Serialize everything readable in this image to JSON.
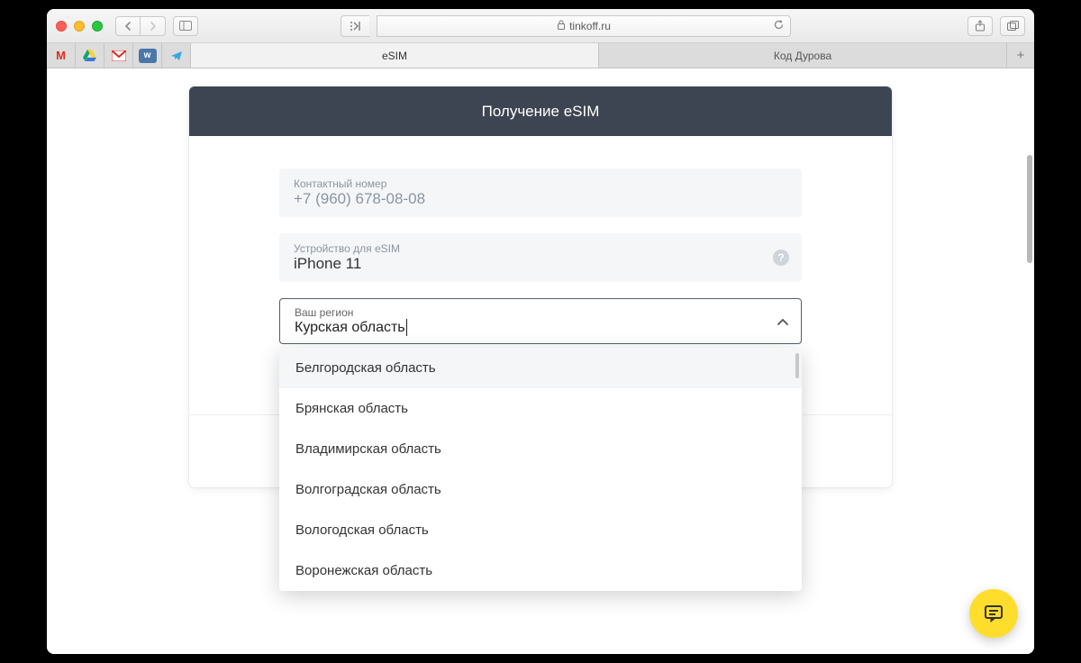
{
  "browser": {
    "url_host": "tinkoff.ru",
    "tabs": [
      {
        "label": "eSIM",
        "active": true
      },
      {
        "label": "Код Дурова",
        "active": false
      }
    ],
    "favicons": [
      "gmail",
      "drive",
      "gmail2",
      "vk",
      "send"
    ]
  },
  "form": {
    "title": "Получение eSIM",
    "contact": {
      "label": "Контактный номер",
      "value": "+7 (960) 678-08-08"
    },
    "device": {
      "label": "Устройство для eSIM",
      "value": "iPhone 11"
    },
    "region": {
      "label": "Ваш регион",
      "value": "Курская область"
    },
    "region_options": [
      "Белгородская область",
      "Брянская область",
      "Владимирская область",
      "Волгоградская область",
      "Вологодская область",
      "Воронежская область"
    ]
  }
}
